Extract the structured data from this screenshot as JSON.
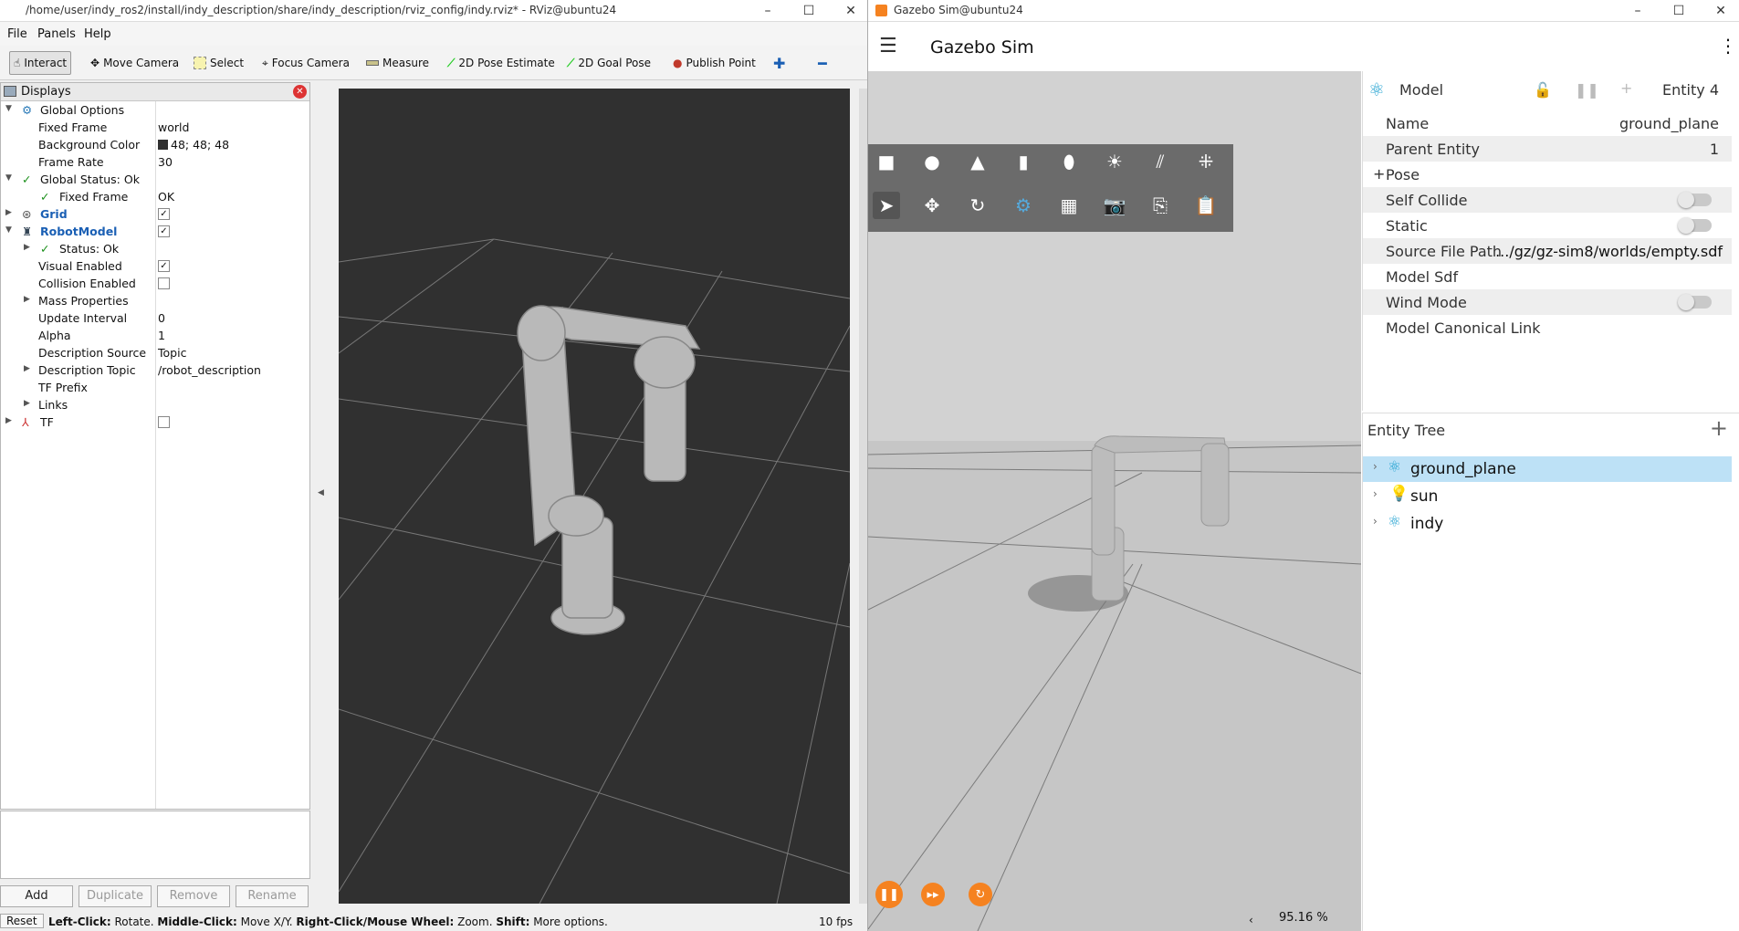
{
  "rviz": {
    "title": "/home/user/indy_ros2/install/indy_description/share/indy_description/rviz_config/indy.rviz* - RViz@ubuntu24",
    "menu": [
      "File",
      "Panels",
      "Help"
    ],
    "tools": [
      "Interact",
      "Move Camera",
      "Select",
      "Focus Camera",
      "Measure",
      "2D Pose Estimate",
      "2D Goal Pose",
      "Publish Point"
    ],
    "displays_title": "Displays",
    "tree": {
      "global_options": "Global Options",
      "fixed_frame_k": "Fixed Frame",
      "fixed_frame_v": "world",
      "bg_color_k": "Background Color",
      "bg_color_v": "48; 48; 48",
      "frame_rate_k": "Frame Rate",
      "frame_rate_v": "30",
      "global_status": "Global Status: Ok",
      "gs_fixed_frame_k": "Fixed Frame",
      "gs_fixed_frame_v": "OK",
      "grid": "Grid",
      "robot_model": "RobotModel",
      "status_ok": "Status: Ok",
      "visual_enabled": "Visual Enabled",
      "collision_enabled": "Collision Enabled",
      "mass_properties": "Mass Properties",
      "update_interval_k": "Update Interval",
      "update_interval_v": "0",
      "alpha_k": "Alpha",
      "alpha_v": "1",
      "desc_source_k": "Description Source",
      "desc_source_v": "Topic",
      "desc_topic_k": "Description Topic",
      "desc_topic_v": "/robot_description",
      "tf_prefix": "TF Prefix",
      "links": "Links",
      "tf": "TF"
    },
    "buttons": {
      "add": "Add",
      "duplicate": "Duplicate",
      "remove": "Remove",
      "rename": "Rename"
    },
    "status": {
      "reset": "Reset",
      "left_click": "Left-Click:",
      "left_click_v": " Rotate. ",
      "middle_click": "Middle-Click:",
      "middle_click_v": " Move X/Y. ",
      "right_click": "Right-Click/Mouse Wheel:",
      "right_click_v": " Zoom. ",
      "shift": "Shift:",
      "shift_v": " More options.",
      "fps": "10 fps"
    },
    "background_color": "#303030"
  },
  "gazebo": {
    "title": "Gazebo Sim@ubuntu24",
    "app_name": "Gazebo Sim",
    "component": {
      "label": "Model",
      "entity": "Entity 4",
      "name_k": "Name",
      "name_v": "ground_plane",
      "parent_k": "Parent Entity",
      "parent_v": "1",
      "pose": "Pose",
      "self_collide": "Self Collide",
      "static": "Static",
      "source_path_k": "Source File Path",
      "source_path_v": ".../gz/gz-sim8/worlds/empty.sdf",
      "model_sdf": "Model Sdf",
      "wind_mode": "Wind Mode",
      "canonical_link": "Model Canonical Link"
    },
    "entity_tree": {
      "title": "Entity Tree",
      "items": [
        "ground_plane",
        "sun",
        "indy"
      ]
    },
    "rtf": "95.16 %",
    "accent": "#f58220",
    "selection": "#bde1f6"
  }
}
